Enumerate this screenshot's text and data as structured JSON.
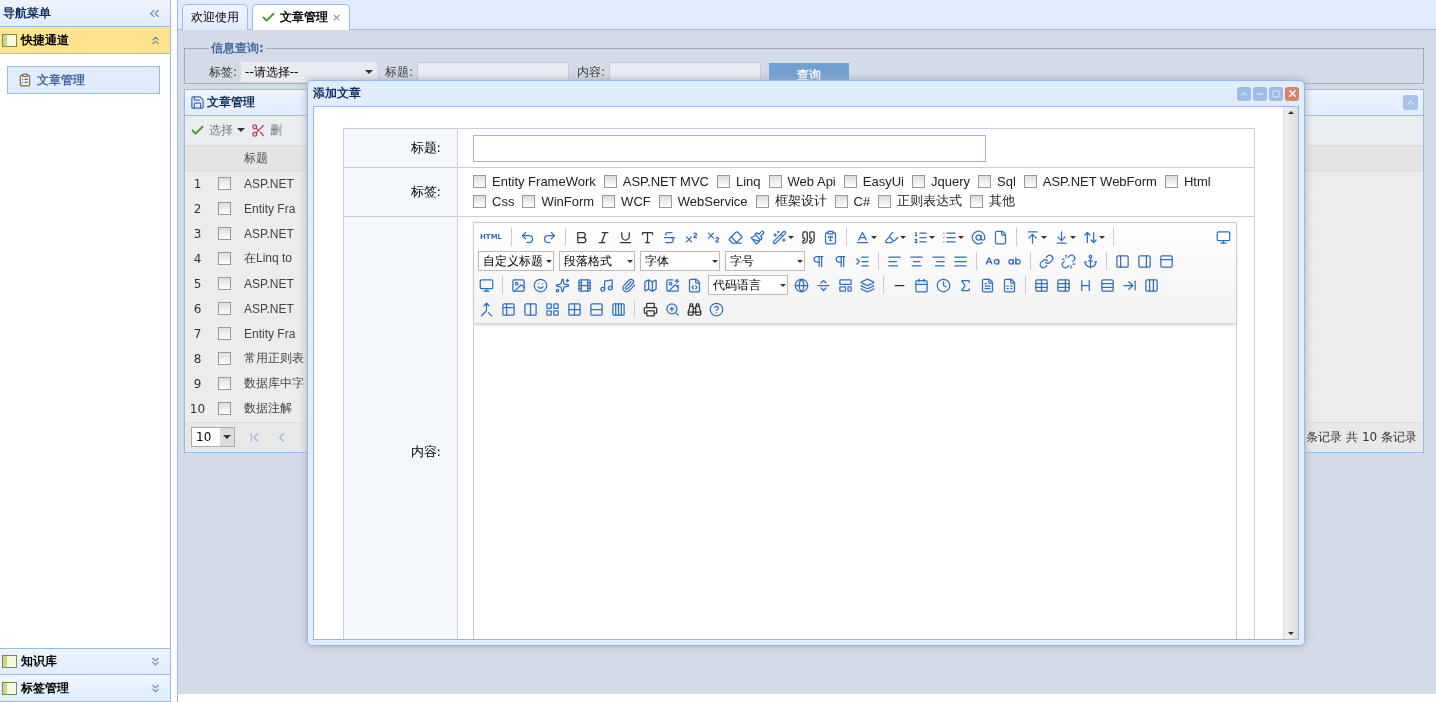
{
  "sidebar": {
    "title": "导航菜单",
    "sections": [
      {
        "title": "快捷通道",
        "expanded": true,
        "items": [
          {
            "label": "文章管理",
            "selected": true
          }
        ]
      },
      {
        "title": "知识库",
        "expanded": false
      },
      {
        "title": "标签管理",
        "expanded": false
      }
    ]
  },
  "tabs": [
    {
      "label": "欢迎使用",
      "selected": false
    },
    {
      "label": "文章管理",
      "selected": true,
      "close": "×"
    }
  ],
  "search": {
    "legend": "信息查询:",
    "fields": [
      {
        "kind": "select",
        "label": "标签:",
        "value": "--请选择--"
      },
      {
        "kind": "input",
        "label": "标题:"
      },
      {
        "kind": "input",
        "label": "内容:"
      }
    ],
    "button": "查询"
  },
  "grid": {
    "title": "文章管理",
    "toolbar": [
      {
        "kind": "menu",
        "label": "选择"
      },
      {
        "kind": "delete",
        "label": "删"
      }
    ],
    "columns": [
      "标题"
    ],
    "rows": [
      {
        "number": "1",
        "checked": false,
        "title": "ASP.NET"
      },
      {
        "number": "2",
        "checked": false,
        "title": "Entity Fra"
      },
      {
        "number": "3",
        "checked": false,
        "title": "ASP.NET"
      },
      {
        "number": "4",
        "checked": false,
        "title": "在Linq to"
      },
      {
        "number": "5",
        "checked": false,
        "title": "ASP.NET"
      },
      {
        "number": "6",
        "checked": false,
        "title": "ASP.NET"
      },
      {
        "number": "7",
        "checked": false,
        "title": "Entity Fra"
      },
      {
        "number": "8",
        "checked": false,
        "title": "常用正则表"
      },
      {
        "number": "9",
        "checked": false,
        "title": "数据库中字"
      },
      {
        "number": "10",
        "checked": false,
        "title": "数据注解"
      }
    ],
    "pager": {
      "page_size": "10",
      "summary": "条记录 共 10 条记录"
    }
  },
  "dialog": {
    "title": "添加文章",
    "title_label": "标题:",
    "tags_label": "标签:",
    "content_label": "内容:",
    "tags": [
      {
        "label": "Entity FrameWork",
        "checked": false
      },
      {
        "label": "ASP.NET MVC",
        "checked": false
      },
      {
        "label": "Linq",
        "checked": false
      },
      {
        "label": "Web Api",
        "checked": false
      },
      {
        "label": "EasyUi",
        "checked": false
      },
      {
        "label": "Jquery",
        "checked": false
      },
      {
        "label": "Sql",
        "checked": false
      },
      {
        "label": "ASP.NET WebForm",
        "checked": false
      },
      {
        "label": "Html",
        "checked": false
      },
      {
        "label": "Css",
        "checked": false
      },
      {
        "label": "WinForm",
        "checked": false
      },
      {
        "label": "WCF",
        "checked": false
      },
      {
        "label": "WebService",
        "checked": false
      },
      {
        "label": "框架设计",
        "checked": false
      },
      {
        "label": "C#",
        "checked": false
      },
      {
        "label": "正则表达式",
        "checked": false
      },
      {
        "label": "其他",
        "checked": false
      }
    ],
    "editor": {
      "html_label": "HTML",
      "selects": [
        "自定义标题",
        "段落格式",
        "字体",
        "字号",
        "代码语言"
      ]
    }
  }
}
